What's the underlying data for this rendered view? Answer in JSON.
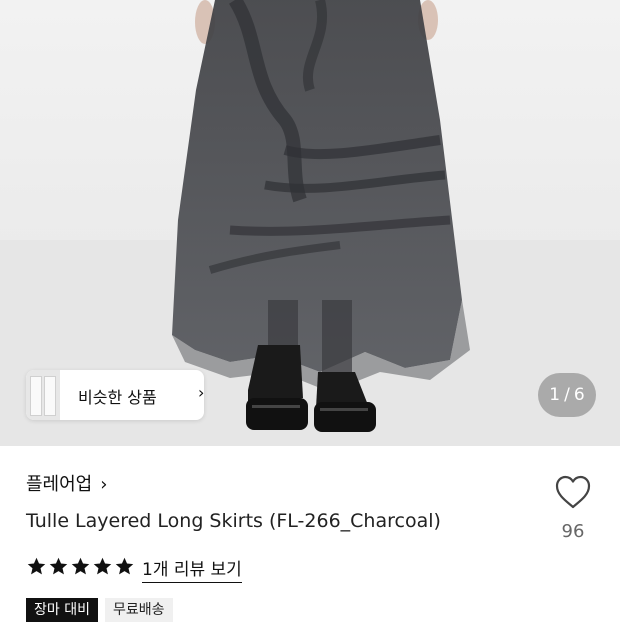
{
  "gallery": {
    "similar_button_label": "비슷한 상품",
    "similar_chevron": "›",
    "counter_current": "1",
    "counter_separator": "/",
    "counter_total": "6"
  },
  "product": {
    "brand_name": "플레어업",
    "brand_chevron": "›",
    "title": "Tulle Layered Long Skirts (FL-266_Charcoal)",
    "like_icon": "heart-outline-icon",
    "like_count": "96",
    "rating_stars": 5,
    "rating_max": 5,
    "review_link": "1개 리뷰 보기",
    "badges": [
      "장마 대비",
      "무료배송"
    ]
  },
  "colors": {
    "background": "#ffffff",
    "photo_background": "#ececec",
    "skirt": "#4a4b4f",
    "boots": "#1a1a1a",
    "badge_dark": "#111111",
    "badge_light": "#f0f0f0",
    "counter_bg": "#787878"
  }
}
